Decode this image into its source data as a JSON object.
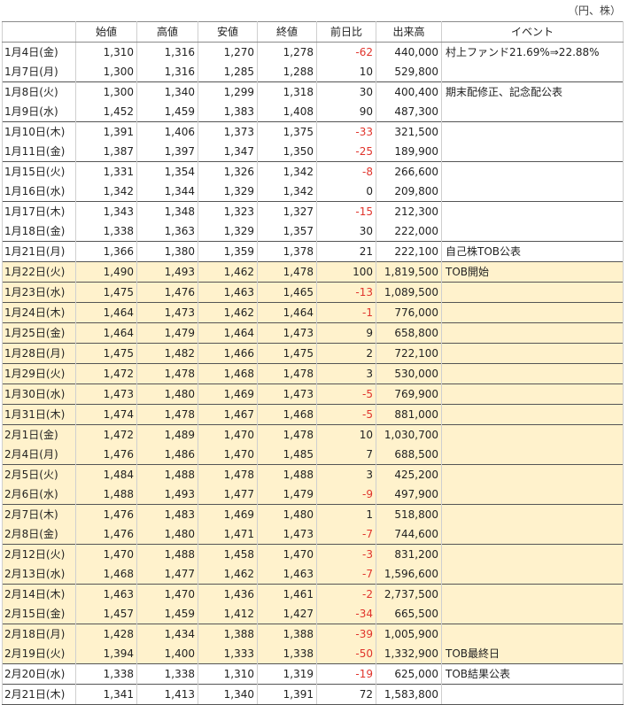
{
  "unit_label": "（円、株）",
  "columns": [
    "",
    "始値",
    "高値",
    "安値",
    "終値",
    "前日比",
    "出来高",
    "イベント"
  ],
  "rows": [
    {
      "date": "1月4日(金)",
      "open": "1,310",
      "high": "1,316",
      "low": "1,270",
      "close": "1,278",
      "change": "-62",
      "volume": "440,000",
      "event": "村上ファンド21.69%⇒22.88%",
      "highlight": false,
      "group_start": true
    },
    {
      "date": "1月7日(月)",
      "open": "1,300",
      "high": "1,316",
      "low": "1,285",
      "close": "1,288",
      "change": "10",
      "volume": "529,800",
      "event": "",
      "highlight": false,
      "group_start": false
    },
    {
      "date": "1月8日(火)",
      "open": "1,300",
      "high": "1,340",
      "low": "1,299",
      "close": "1,318",
      "change": "30",
      "volume": "400,400",
      "event": "期末配修正、記念配公表",
      "highlight": false,
      "group_start": true
    },
    {
      "date": "1月9日(水)",
      "open": "1,452",
      "high": "1,459",
      "low": "1,383",
      "close": "1,408",
      "change": "90",
      "volume": "487,300",
      "event": "",
      "highlight": false,
      "group_start": false
    },
    {
      "date": "1月10日(木)",
      "open": "1,391",
      "high": "1,406",
      "low": "1,373",
      "close": "1,375",
      "change": "-33",
      "volume": "321,500",
      "event": "",
      "highlight": false,
      "group_start": true
    },
    {
      "date": "1月11日(金)",
      "open": "1,387",
      "high": "1,397",
      "low": "1,347",
      "close": "1,350",
      "change": "-25",
      "volume": "189,900",
      "event": "",
      "highlight": false,
      "group_start": false
    },
    {
      "date": "1月15日(火)",
      "open": "1,331",
      "high": "1,354",
      "low": "1,326",
      "close": "1,342",
      "change": "-8",
      "volume": "266,600",
      "event": "",
      "highlight": false,
      "group_start": true
    },
    {
      "date": "1月16日(水)",
      "open": "1,342",
      "high": "1,344",
      "low": "1,329",
      "close": "1,342",
      "change": "0",
      "volume": "209,800",
      "event": "",
      "highlight": false,
      "group_start": false
    },
    {
      "date": "1月17日(木)",
      "open": "1,343",
      "high": "1,348",
      "low": "1,323",
      "close": "1,327",
      "change": "-15",
      "volume": "212,300",
      "event": "",
      "highlight": false,
      "group_start": true
    },
    {
      "date": "1月18日(金)",
      "open": "1,338",
      "high": "1,363",
      "low": "1,329",
      "close": "1,357",
      "change": "30",
      "volume": "222,000",
      "event": "",
      "highlight": false,
      "group_start": false
    },
    {
      "date": "1月21日(月)",
      "open": "1,366",
      "high": "1,380",
      "low": "1,359",
      "close": "1,378",
      "change": "21",
      "volume": "222,100",
      "event": "自己株TOB公表",
      "highlight": false,
      "group_start": true
    },
    {
      "date": "1月22日(火)",
      "open": "1,490",
      "high": "1,493",
      "low": "1,462",
      "close": "1,478",
      "change": "100",
      "volume": "1,819,500",
      "event": "TOB開始",
      "highlight": true,
      "group_start": true
    },
    {
      "date": "1月23日(水)",
      "open": "1,475",
      "high": "1,476",
      "low": "1,463",
      "close": "1,465",
      "change": "-13",
      "volume": "1,089,500",
      "event": "",
      "highlight": true,
      "group_start": true
    },
    {
      "date": "1月24日(木)",
      "open": "1,464",
      "high": "1,473",
      "low": "1,462",
      "close": "1,464",
      "change": "-1",
      "volume": "776,000",
      "event": "",
      "highlight": true,
      "group_start": true
    },
    {
      "date": "1月25日(金)",
      "open": "1,464",
      "high": "1,479",
      "low": "1,464",
      "close": "1,473",
      "change": "9",
      "volume": "658,800",
      "event": "",
      "highlight": true,
      "group_start": true
    },
    {
      "date": "1月28日(月)",
      "open": "1,475",
      "high": "1,482",
      "low": "1,466",
      "close": "1,475",
      "change": "2",
      "volume": "722,100",
      "event": "",
      "highlight": true,
      "group_start": true
    },
    {
      "date": "1月29日(火)",
      "open": "1,472",
      "high": "1,478",
      "low": "1,468",
      "close": "1,478",
      "change": "3",
      "volume": "530,000",
      "event": "",
      "highlight": true,
      "group_start": true
    },
    {
      "date": "1月30日(水)",
      "open": "1,473",
      "high": "1,480",
      "low": "1,469",
      "close": "1,473",
      "change": "-5",
      "volume": "769,900",
      "event": "",
      "highlight": true,
      "group_start": true
    },
    {
      "date": "1月31日(木)",
      "open": "1,474",
      "high": "1,478",
      "low": "1,467",
      "close": "1,468",
      "change": "-5",
      "volume": "881,000",
      "event": "",
      "highlight": true,
      "group_start": true
    },
    {
      "date": "2月1日(金)",
      "open": "1,472",
      "high": "1,489",
      "low": "1,470",
      "close": "1,478",
      "change": "10",
      "volume": "1,030,700",
      "event": "",
      "highlight": true,
      "group_start": true
    },
    {
      "date": "2月4日(月)",
      "open": "1,476",
      "high": "1,486",
      "low": "1,470",
      "close": "1,485",
      "change": "7",
      "volume": "688,500",
      "event": "",
      "highlight": true,
      "group_start": false
    },
    {
      "date": "2月5日(火)",
      "open": "1,484",
      "high": "1,488",
      "low": "1,478",
      "close": "1,488",
      "change": "3",
      "volume": "425,200",
      "event": "",
      "highlight": true,
      "group_start": true
    },
    {
      "date": "2月6日(水)",
      "open": "1,488",
      "high": "1,493",
      "low": "1,477",
      "close": "1,479",
      "change": "-9",
      "volume": "497,900",
      "event": "",
      "highlight": true,
      "group_start": false
    },
    {
      "date": "2月7日(木)",
      "open": "1,476",
      "high": "1,483",
      "low": "1,469",
      "close": "1,480",
      "change": "1",
      "volume": "518,800",
      "event": "",
      "highlight": true,
      "group_start": true
    },
    {
      "date": "2月8日(金)",
      "open": "1,476",
      "high": "1,480",
      "low": "1,471",
      "close": "1,473",
      "change": "-7",
      "volume": "744,600",
      "event": "",
      "highlight": true,
      "group_start": false
    },
    {
      "date": "2月12日(火)",
      "open": "1,470",
      "high": "1,488",
      "low": "1,458",
      "close": "1,470",
      "change": "-3",
      "volume": "831,200",
      "event": "",
      "highlight": true,
      "group_start": true
    },
    {
      "date": "2月13日(水)",
      "open": "1,468",
      "high": "1,477",
      "low": "1,462",
      "close": "1,463",
      "change": "-7",
      "volume": "1,596,600",
      "event": "",
      "highlight": true,
      "group_start": false
    },
    {
      "date": "2月14日(木)",
      "open": "1,463",
      "high": "1,470",
      "low": "1,436",
      "close": "1,461",
      "change": "-2",
      "volume": "2,737,500",
      "event": "",
      "highlight": true,
      "group_start": true
    },
    {
      "date": "2月15日(金)",
      "open": "1,457",
      "high": "1,459",
      "low": "1,412",
      "close": "1,427",
      "change": "-34",
      "volume": "665,500",
      "event": "",
      "highlight": true,
      "group_start": false
    },
    {
      "date": "2月18日(月)",
      "open": "1,428",
      "high": "1,434",
      "low": "1,388",
      "close": "1,388",
      "change": "-39",
      "volume": "1,005,900",
      "event": "",
      "highlight": true,
      "group_start": true
    },
    {
      "date": "2月19日(火)",
      "open": "1,394",
      "high": "1,400",
      "low": "1,333",
      "close": "1,338",
      "change": "-50",
      "volume": "1,332,900",
      "event": "TOB最終日",
      "highlight": true,
      "group_start": false
    },
    {
      "date": "2月20日(水)",
      "open": "1,338",
      "high": "1,338",
      "low": "1,310",
      "close": "1,319",
      "change": "-19",
      "volume": "625,000",
      "event": "TOB結果公表",
      "highlight": false,
      "group_start": true
    },
    {
      "date": "2月21日(木)",
      "open": "1,341",
      "high": "1,413",
      "low": "1,340",
      "close": "1,391",
      "change": "72",
      "volume": "1,583,800",
      "event": "",
      "highlight": false,
      "group_start": true
    }
  ]
}
